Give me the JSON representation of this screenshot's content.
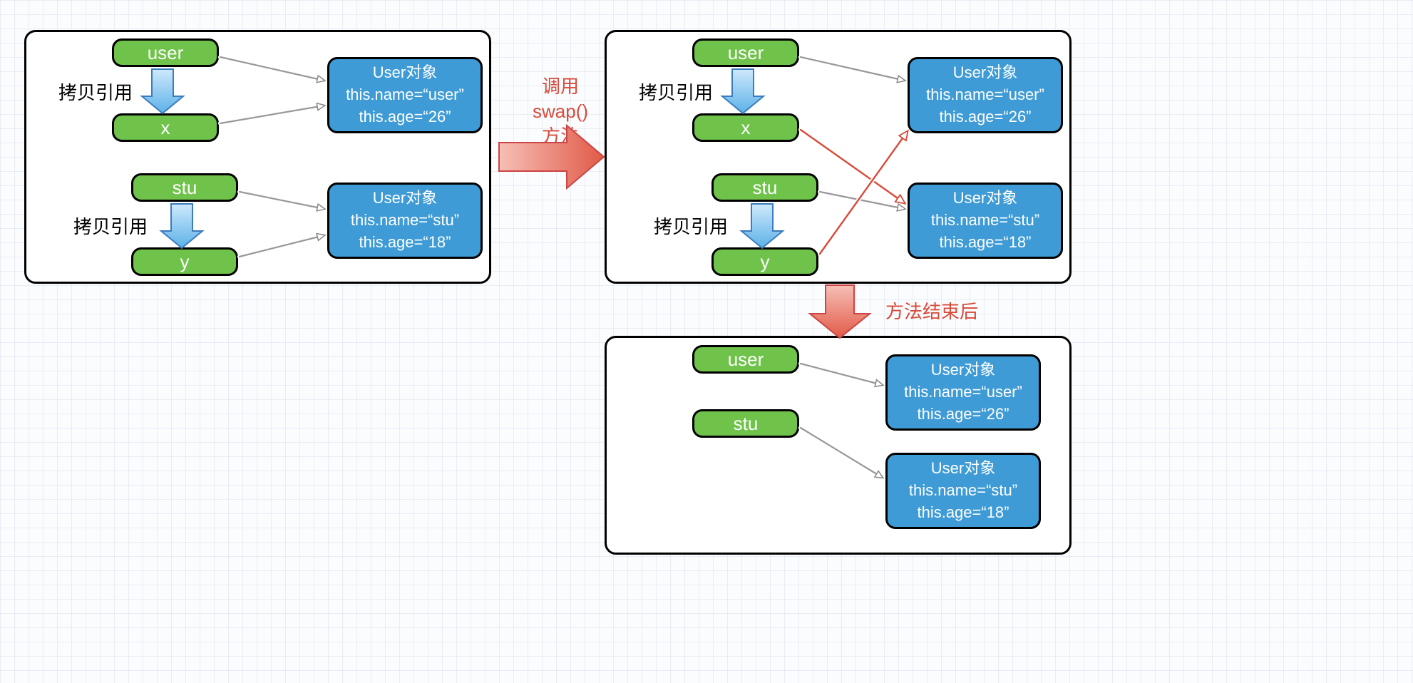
{
  "labels": {
    "copyRef": "拷贝引用",
    "callSwap": "调用\nswap()\n方法",
    "afterMethod": "方法结束后"
  },
  "vars": {
    "user": "user",
    "x": "x",
    "stu": "stu",
    "y": "y"
  },
  "objects": {
    "userObj": "User对象\nthis.name=“user”\nthis.age=“26”",
    "stuObj": "User对象\nthis.name=“stu”\nthis.age=“18”"
  }
}
